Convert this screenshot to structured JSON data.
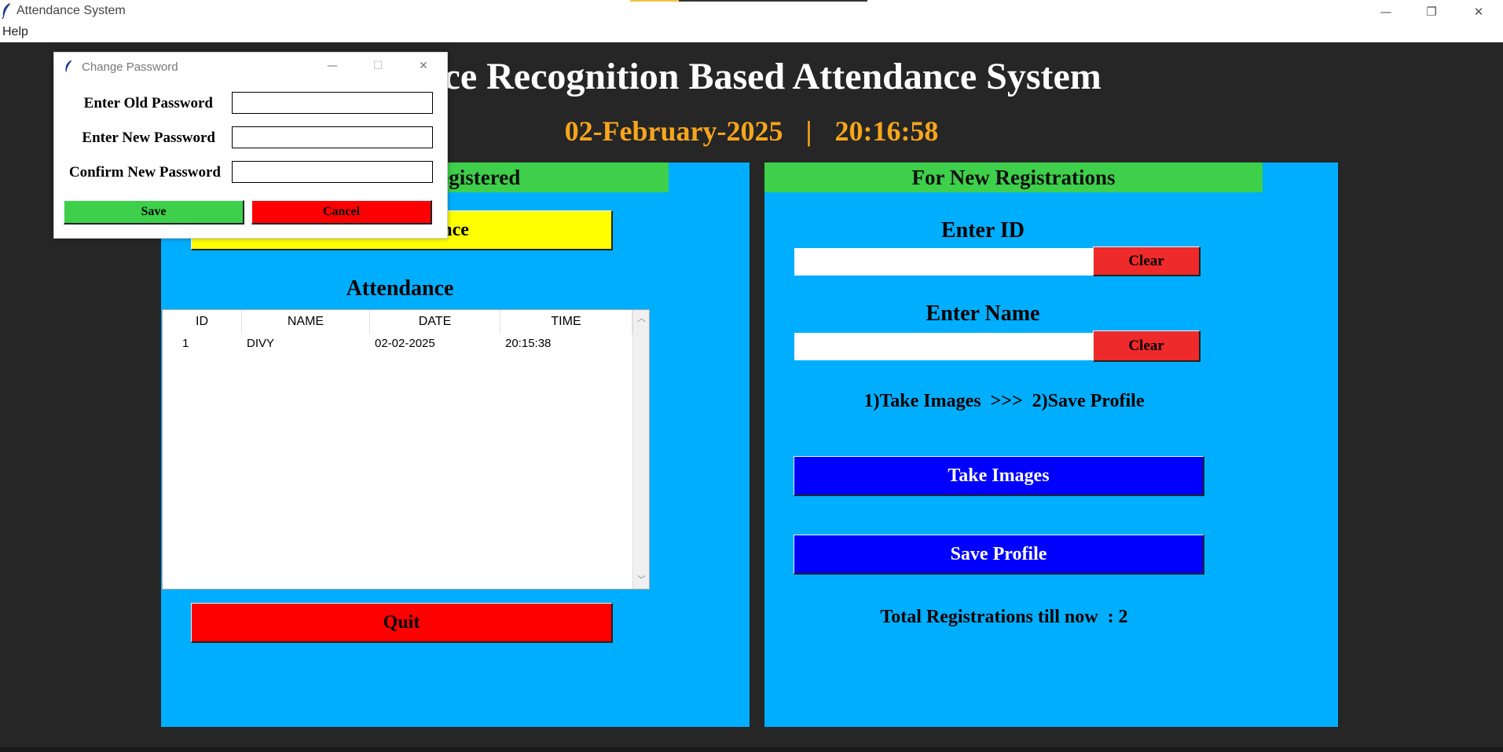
{
  "window": {
    "title": "Attendance System",
    "minimize_glyph": "—",
    "restore_glyph": "❐",
    "close_glyph": "✕"
  },
  "menu": {
    "help": "Help"
  },
  "header": {
    "title": "Face Recognition Based Attendance System",
    "date": "02-February-2025",
    "separator": "|",
    "time": "20:16:58"
  },
  "left_panel": {
    "header": "For Already Registered",
    "take_attendance_label": "Take Attendance",
    "attendance_label": "Attendance",
    "table": {
      "columns": [
        "ID",
        "NAME",
        "DATE",
        "TIME"
      ],
      "rows": [
        {
          "id": "1",
          "name": "DIVY",
          "date": "02-02-2025",
          "time": "20:15:38"
        }
      ]
    },
    "quit_label": "Quit"
  },
  "right_panel": {
    "header": "For New Registrations",
    "enter_id_label": "Enter ID",
    "id_value": "",
    "clear_id_label": "Clear",
    "enter_name_label": "Enter Name",
    "name_value": "",
    "clear_name_label": "Clear",
    "steps_label": "1)Take Images  >>>  2)Save Profile",
    "take_images_label": "Take Images",
    "save_profile_label": "Save Profile",
    "total_registrations_label": "Total Registrations till now  : 2"
  },
  "dialog": {
    "title": "Change Password",
    "old_password_label": "Enter Old Password",
    "new_password_label": "Enter New Password",
    "confirm_password_label": "Confirm New Password",
    "save_label": "Save",
    "cancel_label": "Cancel",
    "minimize_glyph": "—",
    "maximize_glyph": "☐",
    "close_glyph": "✕"
  },
  "colors": {
    "background": "#262626",
    "panel": "#00aeff",
    "header_green": "#3ecf4b",
    "datetime_orange": "#f7a51d",
    "attendance_yellow": "#ffff00",
    "quit_red": "#ff0000",
    "clear_red": "#ee2a2a",
    "action_blue": "#0000ff"
  },
  "icons": [
    "feather-icon",
    "minimize-icon",
    "restore-icon",
    "close-icon",
    "scroll-up-icon",
    "scroll-down-icon"
  ]
}
